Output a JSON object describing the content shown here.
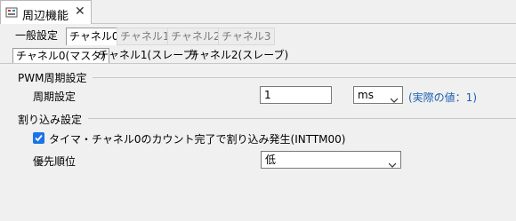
{
  "window": {
    "tab_title": "周辺機能",
    "close_glyph": "✕"
  },
  "top_tabs": [
    {
      "label": "一般設定",
      "state": "plain"
    },
    {
      "label": "チャネル0",
      "state": "active"
    },
    {
      "label": "チャネル1",
      "state": "inactive"
    },
    {
      "label": "チャネル2",
      "state": "inactive"
    },
    {
      "label": "チャネル3",
      "state": "inactive"
    }
  ],
  "sub_tabs": [
    {
      "label": "チャネル0(マスタ)",
      "state": "active"
    },
    {
      "label": "チャネル1(スレーブ)",
      "state": "plain"
    },
    {
      "label": "チャネル2(スレーブ)",
      "state": "plain"
    }
  ],
  "pwm_group": {
    "title": "PWM周期設定",
    "period_label": "周期設定",
    "period_value": "1",
    "unit_value": "ms",
    "actual_hint": "(実際の値：1)"
  },
  "interrupt_group": {
    "title": "割り込み設定",
    "checkbox_label": "タイマ・チャネル0のカウント完了で割り込み発生(INTTM00)",
    "checkbox_checked": true,
    "priority_label": "優先順位",
    "priority_value": "低"
  },
  "colors": {
    "accent": "#1a73e8",
    "hint": "#1a5fb4"
  }
}
